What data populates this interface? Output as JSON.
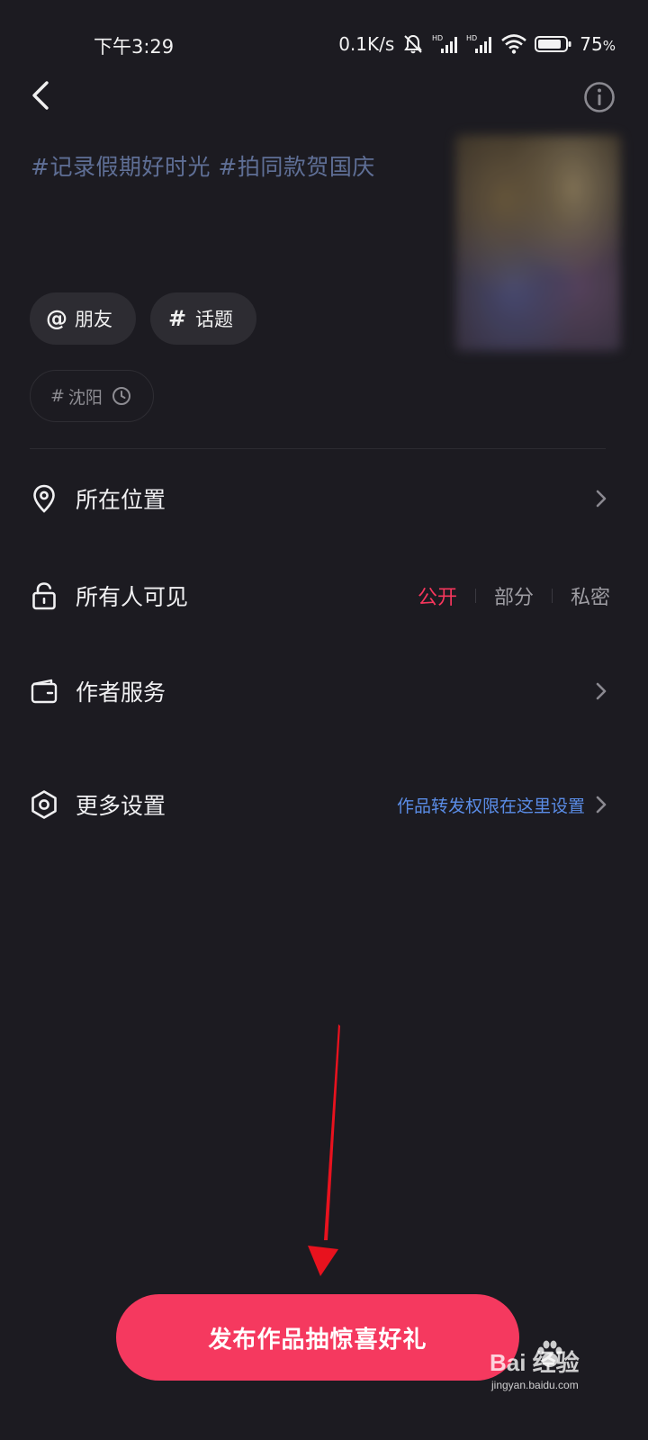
{
  "status_bar": {
    "time": "下午3:29",
    "net_speed": "0.1K/s",
    "battery": "75",
    "battery_unit": "%",
    "icons": [
      "mute-bell-icon",
      "hd-signal-icon",
      "hd-signal-icon",
      "wifi-icon",
      "battery-icon"
    ]
  },
  "header": {
    "back_icon": "chevron-left-icon",
    "info_icon": "info-icon"
  },
  "post": {
    "caption": "#记录假期好时光 #拍同款贺国庆",
    "chips": [
      {
        "glyph": "@",
        "label": "朋友",
        "icon": "at-icon"
      },
      {
        "glyph": "#",
        "label": "话题",
        "icon": "hash-icon"
      }
    ],
    "location_chip": {
      "glyph": "#",
      "label": "沈阳",
      "icon": "clock-icon"
    }
  },
  "settings": {
    "location": {
      "label": "所在位置",
      "icon": "location-pin-icon"
    },
    "visibility": {
      "label": "所有人可见",
      "icon": "unlock-icon",
      "options": [
        "公开",
        "部分",
        "私密"
      ],
      "selected": "公开"
    },
    "author_service": {
      "label": "作者服务",
      "icon": "wallet-icon"
    },
    "more": {
      "label": "更多设置",
      "icon": "hexagon-settings-icon",
      "hint": "作品转发权限在这里设置"
    }
  },
  "publish_button": {
    "label": "发布作品抽惊喜好礼"
  },
  "watermark": {
    "main": "Bai  经验",
    "sub": "jingyan.baidu.com"
  },
  "colors": {
    "background": "#1c1b21",
    "accent": "#f5395f",
    "link": "#5a8ce6",
    "caption": "#5f6f96",
    "annotation_arrow": "#e8121e"
  }
}
